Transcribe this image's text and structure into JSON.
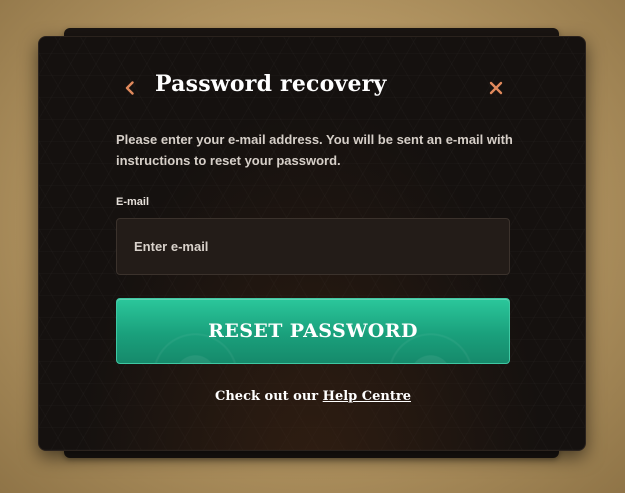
{
  "modal": {
    "title": "Password recovery",
    "description": "Please enter your e-mail address. You will be sent an e-mail with instructions to reset your password.",
    "email_label": "E-mail",
    "email_placeholder": "Enter e-mail",
    "email_value": "",
    "reset_button_label": "RESET PASSWORD",
    "help_prefix": "Check out our ",
    "help_link_label": "Help Centre"
  },
  "icons": {
    "back": "chevron-left-icon",
    "close": "close-icon"
  },
  "colors": {
    "accent": "#e0895c",
    "button": "#1fa983",
    "modal_bg": "#15110f",
    "page_bg": "#c4a674"
  }
}
